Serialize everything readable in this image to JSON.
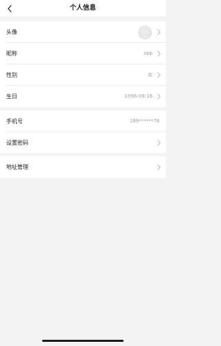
{
  "header": {
    "title": "个人信息",
    "back_icon": "chevron-left-icon"
  },
  "profile": {
    "avatar": {
      "label": "头像"
    },
    "nickname": {
      "label": "昵称",
      "value": "app"
    },
    "gender": {
      "label": "性别",
      "value": "女"
    },
    "birthday": {
      "label": "生日",
      "value": "1996-08-16"
    }
  },
  "account": {
    "phone": {
      "label": "手机号",
      "value": "189******76"
    },
    "password": {
      "label": "设置密码"
    }
  },
  "address": {
    "manage": {
      "label": "地址管理"
    }
  },
  "colors": {
    "page_background": "#f3f3f3",
    "card_background": "#ffffff",
    "label_text": "#222222",
    "value_text": "#a0a0a0",
    "chevron": "#b8b8b8"
  }
}
